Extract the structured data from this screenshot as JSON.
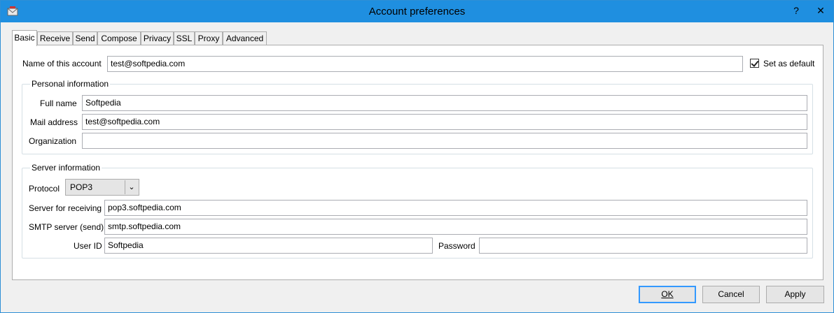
{
  "window": {
    "title": "Account preferences",
    "help_glyph": "?",
    "close_glyph": "✕"
  },
  "tabs": [
    {
      "label": "Basic"
    },
    {
      "label": "Receive"
    },
    {
      "label": "Send"
    },
    {
      "label": "Compose"
    },
    {
      "label": "Privacy"
    },
    {
      "label": "SSL"
    },
    {
      "label": "Proxy"
    },
    {
      "label": "Advanced"
    }
  ],
  "account": {
    "name_label": "Name of this account",
    "name_value": "test@softpedia.com",
    "default_label": "Set as default",
    "default_checked": true
  },
  "personal": {
    "title": "Personal information",
    "fullname_label": "Full name",
    "fullname_value": "Softpedia",
    "mail_label": "Mail address",
    "mail_value": "test@softpedia.com",
    "org_label": "Organization",
    "org_value": ""
  },
  "server": {
    "title": "Server information",
    "protocol_label": "Protocol",
    "protocol_value": "POP3",
    "receive_label": "Server for receiving",
    "receive_value": "pop3.softpedia.com",
    "smtp_label": "SMTP server (send)",
    "smtp_value": "smtp.softpedia.com",
    "userid_label": "User ID",
    "userid_value": "Softpedia",
    "password_label": "Password",
    "password_value": ""
  },
  "buttons": {
    "ok": "OK",
    "cancel": "Cancel",
    "apply": "Apply"
  }
}
